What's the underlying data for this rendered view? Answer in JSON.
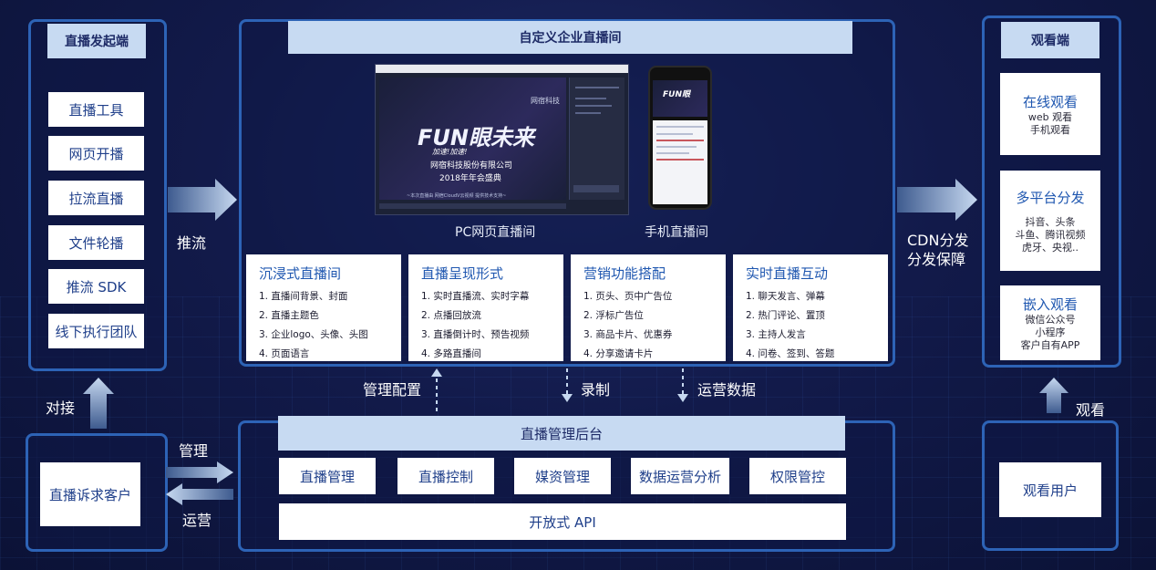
{
  "left_panel": {
    "title": "直播发起端",
    "items": [
      "直播工具",
      "网页开播",
      "拉流直播",
      "文件轮播",
      "推流 SDK",
      "线下执行团队"
    ]
  },
  "center_panel": {
    "title": "自定义企业直播间",
    "pc_caption": "PC网页直播间",
    "mobile_caption": "手机直播间",
    "preview": {
      "brand": "网宿科技",
      "slogan": "FUN眼未来",
      "slogan_sub": "加速!加速!",
      "company": "网宿科技股份有限公司",
      "event": "2018年年会盛典",
      "note": "~本次直播由 网宿CloudV云视频 提供技术支持~"
    },
    "cards": [
      {
        "title": "沉浸式直播间",
        "items": [
          "1. 直播间背景、封面",
          "2. 直播主题色",
          "3. 企业logo、头像、头图",
          "4. 页面语言"
        ]
      },
      {
        "title": "直播呈现形式",
        "items": [
          "1. 实时直播流、实时字幕",
          "2. 点播回放流",
          "3. 直播倒计时、预告视频",
          "4. 多路直播间"
        ]
      },
      {
        "title": "营销功能搭配",
        "items": [
          "1. 页头、页中广告位",
          "2. 浮标广告位",
          "3. 商品卡片、优惠券",
          "4. 分享邀请卡片"
        ]
      },
      {
        "title": "实时直播互动",
        "items": [
          "1. 聊天发言、弹幕",
          "2. 热门评论、置顶",
          "3. 主持人发言",
          "4. 问卷、签到、答题"
        ]
      }
    ]
  },
  "right_panel": {
    "title": "观看端",
    "boxes": [
      {
        "title": "在线观看",
        "subs": [
          "web 观看",
          "手机观看"
        ]
      },
      {
        "title": "多平台分发",
        "subs": [
          "抖音、头条",
          "斗鱼、腾讯视频",
          "虎牙、央视.."
        ]
      },
      {
        "title": "嵌入观看",
        "subs": [
          "微信公众号",
          "小程序",
          "客户自有APP"
        ]
      }
    ]
  },
  "backend_panel": {
    "title": "直播管理后台",
    "items": [
      "直播管理",
      "直播控制",
      "媒资管理",
      "数据运营分析",
      "权限管控"
    ],
    "api": "开放式 API"
  },
  "customer": {
    "label": "直播诉求客户"
  },
  "viewer": {
    "label": "观看用户"
  },
  "flows": {
    "push": "推流",
    "cdn_line1": "CDN分发",
    "cdn_line2": "分发保障",
    "dock": "对接",
    "manage": "管理",
    "operate": "运营",
    "config": "管理配置",
    "record": "录制",
    "ops_data": "运营数据",
    "watch": "观看"
  }
}
